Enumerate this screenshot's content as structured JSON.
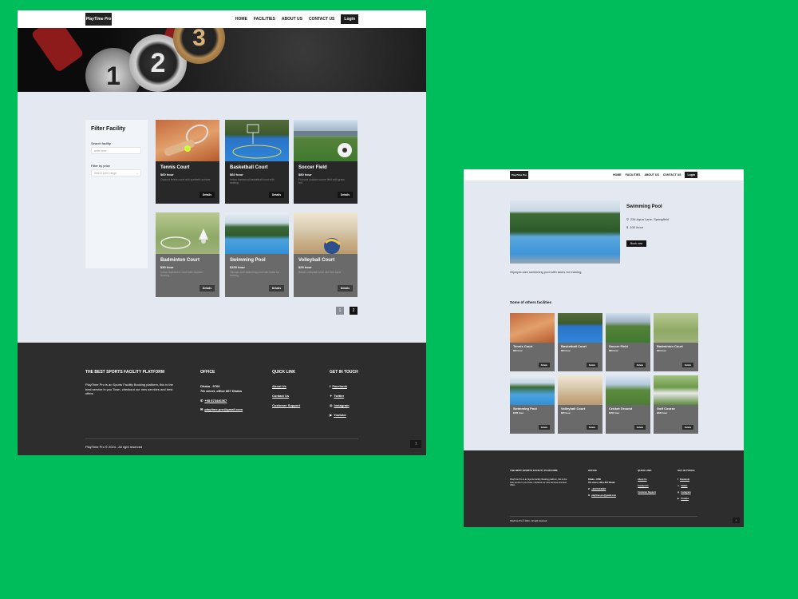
{
  "brand": "PlayTime Pro",
  "nav": {
    "home": "HOME",
    "facilities": "FACILITIES",
    "about": "ABOUT US",
    "contact": "CONTACT US",
    "login": "Login"
  },
  "list_page": {
    "filter": {
      "title": "Filter Facility",
      "search_label": "Search facility",
      "search_placeholder": "write here...",
      "price_label": "Filter by price",
      "price_placeholder": "Select price range"
    },
    "cards": [
      {
        "title": "Tennis Court",
        "price": "$60 hour",
        "desc": "Outdoor tennis court with synthetic surface.",
        "btn": "Details"
      },
      {
        "title": "Basketball Court",
        "price": "$60 hour",
        "desc": "Indoor hardwood basketball court with seating.",
        "btn": "Details"
      },
      {
        "title": "Soccer Field",
        "price": "$80 hour",
        "desc": "Full-size outdoor soccer field with grass turf.",
        "btn": "Details"
      },
      {
        "title": "Badminton Court",
        "price": "$30 hour",
        "desc": "Indoor badminton court with wooden flooring.",
        "btn": "Details"
      },
      {
        "title": "Swimming Pool",
        "price": "$100 hour",
        "desc": "Olympic-size swimming pool with lanes for training.",
        "btn": "Details"
      },
      {
        "title": "Volleyball Court",
        "price": "$25 hour",
        "desc": "Beach volleyball court with fine sand.",
        "btn": "Details"
      }
    ],
    "pages": [
      "1",
      "2"
    ]
  },
  "footer": {
    "platform_title": "THE BEST SPORTS FACILITY PLATFORM",
    "platform_text": "PlayTime Pro is an Sports Facility Booking platform, this is the best service in you Town, checkout our new services and best offers",
    "office_title": "OFFICE",
    "office_line1": "Dhaka - 9766",
    "office_line2": "7th street, office 867 Dhaka",
    "phone": "+98 873446367",
    "email": "playtime-pro@gmail.com",
    "quick_title": "QUICK LINK",
    "quick": [
      "About Us",
      "Contact Us",
      "Customer Support"
    ],
    "touch_title": "GET IN TOUCH",
    "social": [
      "Facebook",
      "Twitter",
      "Instagram",
      "Youtube"
    ],
    "copyright": "PlayTime Pro  © 2024 - All right reserved",
    "up": "↑"
  },
  "detail_page": {
    "nav": {
      "home": "HOME",
      "facilities": "FACILITIES",
      "about": "ABOUT US",
      "contact": "CONTACT US",
      "login": "Login"
    },
    "title": "Swimming Pool",
    "address": "234 Aqua Lane, Springfield",
    "price": "100 /hour",
    "book": "Book now",
    "desc": "Olympic-size swimming pool with lanes for training.",
    "others_title": "Some of others facilities",
    "others": [
      {
        "title": "Tennis Court",
        "price": "$60 hour",
        "btn": "Details"
      },
      {
        "title": "Basketball Court",
        "price": "$60 hour",
        "btn": "Details"
      },
      {
        "title": "Soccer Field",
        "price": "$80 hour",
        "btn": "Details"
      },
      {
        "title": "Badminton Court",
        "price": "$30 hour",
        "btn": "Details"
      },
      {
        "title": "Swimming Pool",
        "price": "$100 hour",
        "btn": "Details"
      },
      {
        "title": "Volleyball Court",
        "price": "$25 hour",
        "btn": "Details"
      },
      {
        "title": "Cricket Ground",
        "price": "$150 hour",
        "btn": "Details"
      },
      {
        "title": "Golf Course",
        "price": "$200 hour",
        "btn": "Details"
      }
    ]
  }
}
